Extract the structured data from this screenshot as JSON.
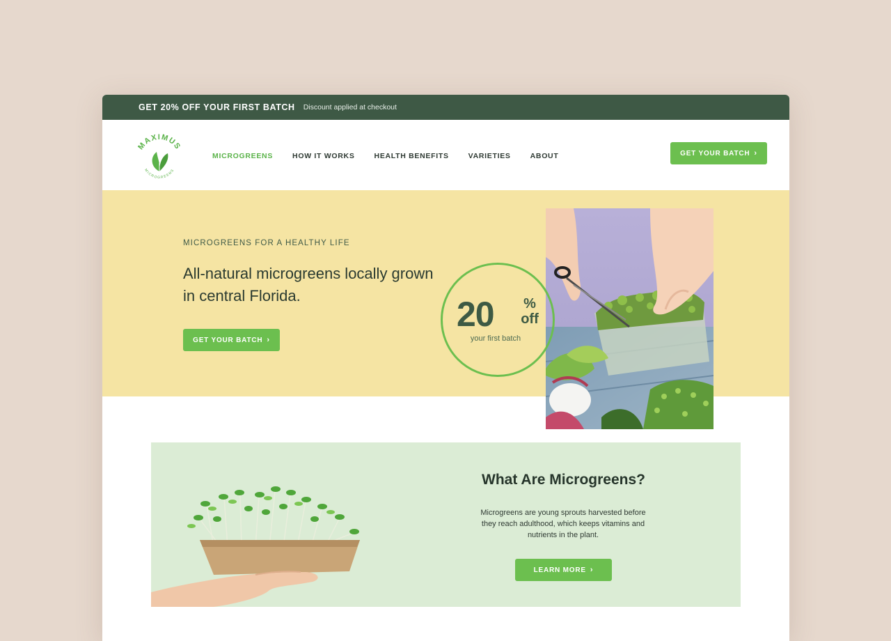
{
  "promo": {
    "title": "GET 20% OFF YOUR FIRST BATCH",
    "subtitle": "Discount applied at checkout"
  },
  "brand": {
    "name": "MAXIMUS",
    "tagline": "MICROGREENS",
    "logo_icon": "leaf-icon"
  },
  "nav": {
    "items": [
      {
        "label": "MICROGREENS",
        "active": true
      },
      {
        "label": "HOW IT WORKS",
        "active": false
      },
      {
        "label": "HEALTH BENEFITS",
        "active": false
      },
      {
        "label": "VARIETIES",
        "active": false
      },
      {
        "label": "ABOUT",
        "active": false
      }
    ],
    "cta_label": "GET YOUR BATCH",
    "cta_icon": "chevron-right-icon"
  },
  "hero": {
    "eyebrow": "MICROGREENS FOR A HEALTHY LIFE",
    "title": "All-natural microgreens locally grown in central Florida.",
    "cta_label": "GET YOUR BATCH",
    "discount": {
      "number": "20",
      "percent": "%",
      "off": "off",
      "caption": "your first batch"
    }
  },
  "info": {
    "title": "What Are Microgreens?",
    "text": "Microgreens are young sprouts harvested before they reach adulthood, which keeps vitamins and nutrients in the plant.",
    "cta_label": "LEARN MORE"
  },
  "colors": {
    "background": "#e6d8cd",
    "promo_bar": "#3e5945",
    "accent_green": "#6cbf4f",
    "hero_yellow": "#f5e4a3",
    "info_green": "#dbecd5",
    "text_dark": "#2a3a30"
  }
}
